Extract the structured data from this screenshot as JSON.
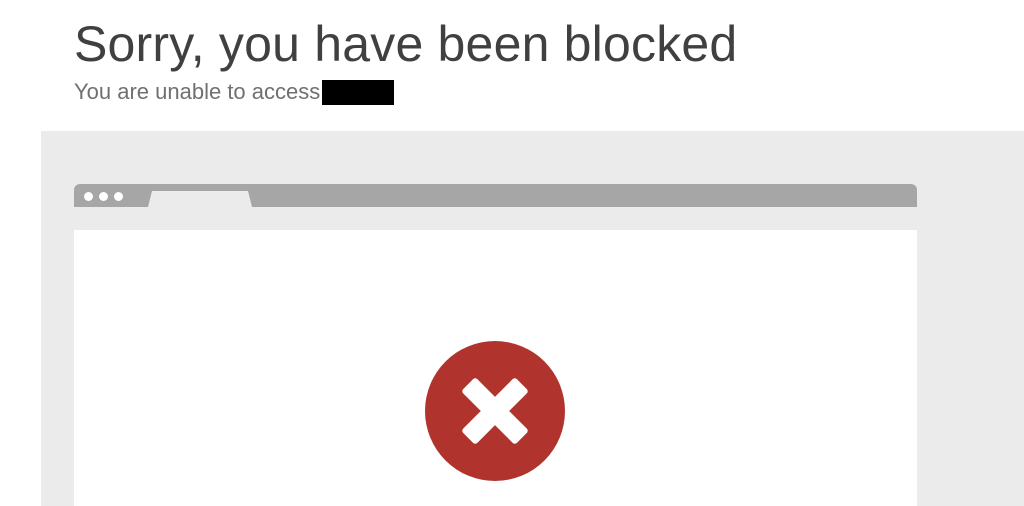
{
  "page": {
    "title": "Sorry, you have been blocked",
    "subtitle": "You are unable to access"
  },
  "icons": {
    "browser_dots": "window-dots-icon",
    "error": "error-x-icon"
  },
  "colors": {
    "error_red": "#b0342d",
    "panel_gray": "#ebebeb",
    "bar_gray": "#a6a6a6",
    "title_text": "#404040",
    "subtitle_text": "#707070"
  }
}
